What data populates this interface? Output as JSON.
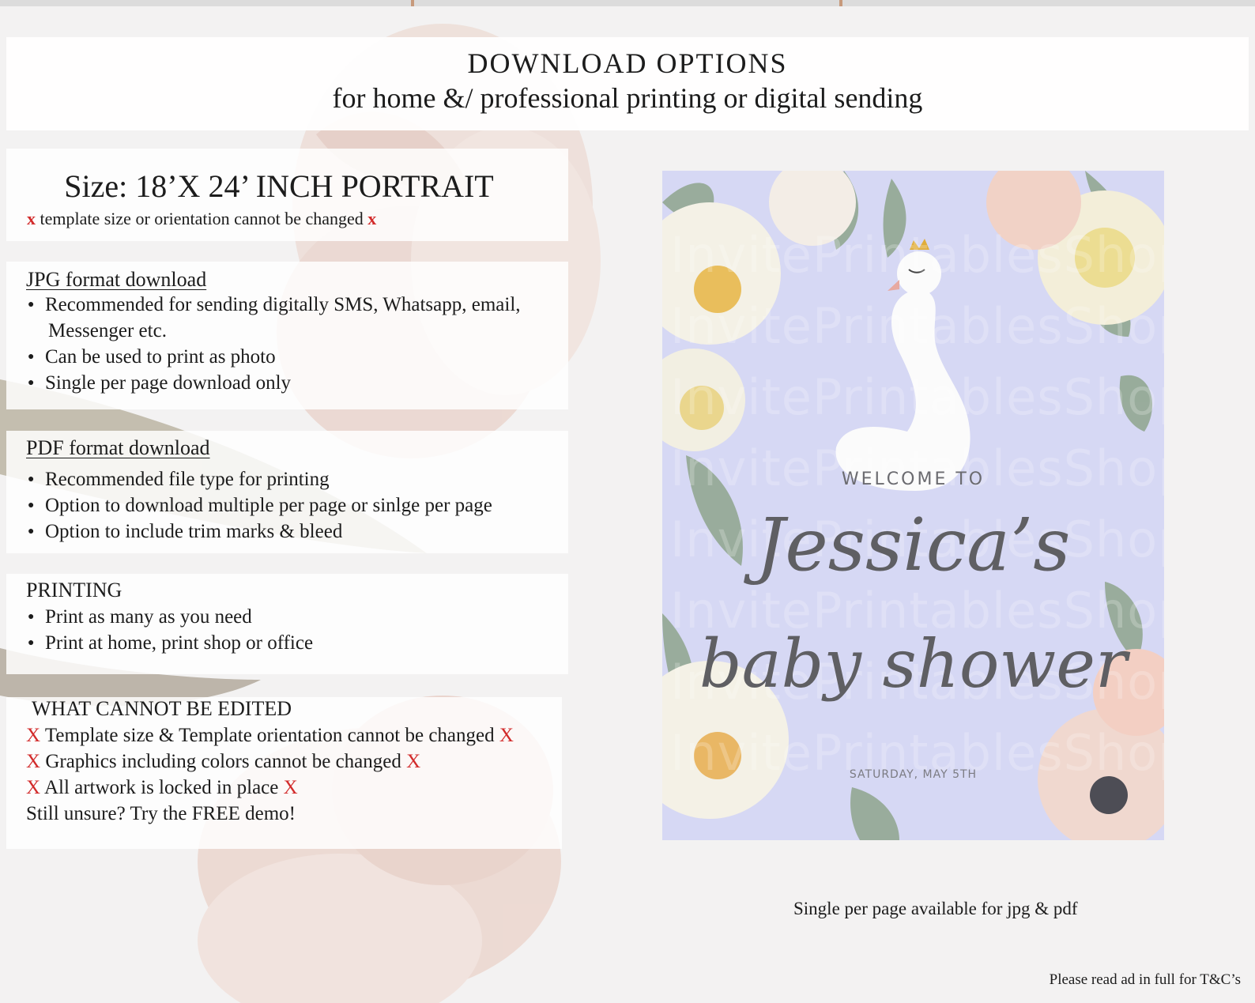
{
  "header": {
    "title": "DOWNLOAD OPTIONS",
    "subtitle": "for home &/ professional printing or digital sending"
  },
  "size": {
    "title": "Size: 18’X 24’ INCH PORTRAIT",
    "note_prefix": "x",
    "note": "template size or orientation cannot be changed",
    "note_suffix": "x"
  },
  "jpg": {
    "heading": "JPG format download",
    "bullet1_line1": "Recommended for sending digitally SMS, Whatsapp, email,",
    "bullet1_line2": "Messenger etc.",
    "bullet2": "Can be used to print as photo",
    "bullet3": "Single per page download only"
  },
  "pdf": {
    "heading": "PDF format download",
    "bullet1": "Recommended file type for printing",
    "bullet2": "Option to download multiple per page or sinlge per page",
    "bullet3": "Option to include trim marks & bleed"
  },
  "printing": {
    "heading": "PRINTING",
    "bullet1": "Print as many as you need",
    "bullet2": "Print at home, print shop or office"
  },
  "edit": {
    "heading": "WHAT CANNOT BE EDITED",
    "x_mark": "X",
    "line1": "Template size & Template orientation cannot be changed",
    "line2": "Graphics including colors cannot be changed",
    "line3": "All artwork is locked in place",
    "line4": "Still unsure? Try the FREE demo!"
  },
  "poster": {
    "welcome": "WELCOME TO",
    "name": "Jessica’s",
    "event": "baby shower",
    "date": "SATURDAY, MAY 5TH",
    "watermark": "InvitePrintablesShop",
    "background_color": "#d6d8f4"
  },
  "caption": "Single per page available for jpg & pdf",
  "footer_note": "Please read ad in full for T&C’s",
  "colors": {
    "accent_red": "#d22b2b",
    "text": "#1c1c1c",
    "petal_pink": "#e9c9bd"
  }
}
